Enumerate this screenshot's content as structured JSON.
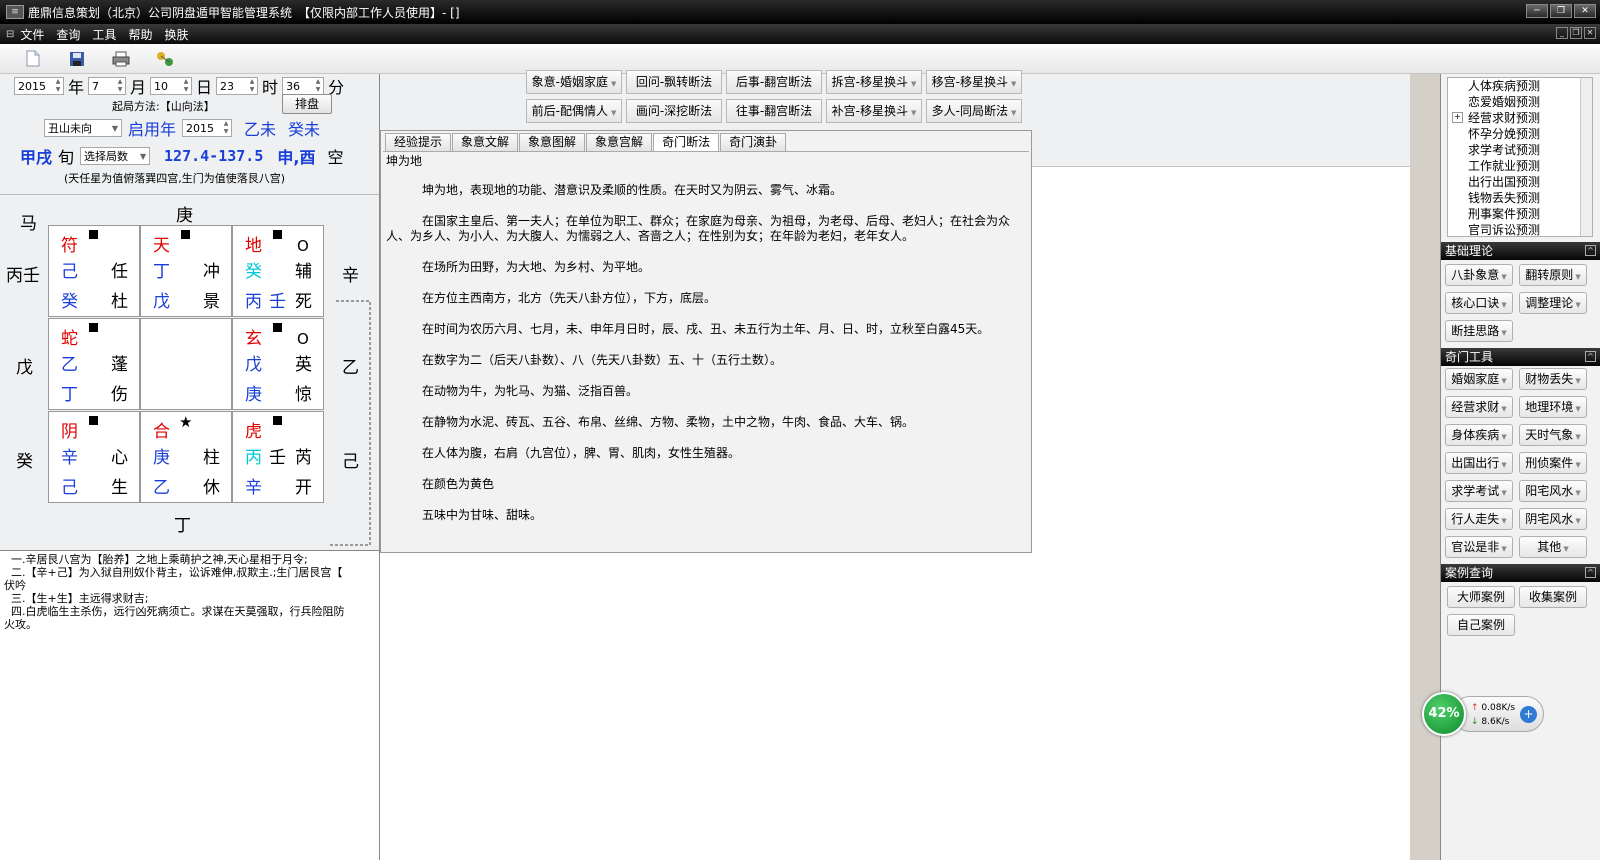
{
  "titlebar": {
    "title": "鹿鼎信息策划（北京）公司阴盘遁甲智能管理系统　【仅限内部工作人员使用】- []"
  },
  "menu": [
    "文件",
    "查询",
    "工具",
    "帮助",
    "换肤"
  ],
  "toolbar": {
    "icons": [
      "document-icon",
      "save-icon",
      "print-icon",
      "network-icon"
    ]
  },
  "left": {
    "date": {
      "year": "2015",
      "year_lbl": "年",
      "month": "7",
      "month_lbl": "月",
      "day": "10",
      "day_lbl": "日",
      "hour": "23",
      "hour_lbl": "时",
      "minute": "36",
      "minute_lbl": "分"
    },
    "method_label": "起局方法:【山向法】",
    "paipan_button": "排盘",
    "mountain": "丑山未向",
    "qiyong_label": "启用年",
    "qiyong_year": "2015",
    "ganzhi1": "乙未",
    "ganzhi2": "癸未",
    "xun_name": "甲戌",
    "xun_lbl": "旬",
    "select_ju": "选择局数",
    "degree": "127.4-137.5",
    "kong": "申,酉",
    "kong_lbl": "空",
    "note": "(天任星为值俯落巽四宫,生门为值使落艮八宫)"
  },
  "chart": {
    "outer": {
      "ma": "马",
      "top": "庚",
      "left1": "丙壬",
      "left2": "戊",
      "left3": "癸",
      "right1": "辛",
      "right2": "乙",
      "right3": "己",
      "bottom": "丁"
    },
    "cells": {
      "c1": {
        "god": "符",
        "stem1": "己",
        "star": "任",
        "stem2": "癸",
        "door": "杜"
      },
      "c2": {
        "god": "天",
        "stem1": "丁",
        "star": "冲",
        "stem2": "戊",
        "door": "景"
      },
      "c3": {
        "god": "地",
        "stem1": "癸",
        "star": "辅",
        "stem2": "丙",
        "extra": "壬",
        "door": "死",
        "mark": "O"
      },
      "c4": {
        "god": "蛇",
        "stem1": "乙",
        "star": "蓬",
        "stem2": "丁",
        "door": "伤"
      },
      "c6": {
        "god": "玄",
        "stem1": "戊",
        "star": "英",
        "stem2": "庚",
        "door": "惊",
        "mark": "O"
      },
      "c7": {
        "god": "阴",
        "stem1": "辛",
        "star": "心",
        "stem2": "己",
        "door": "生"
      },
      "c8": {
        "god": "合",
        "stem1": "庚",
        "star": "柱",
        "stem2": "乙",
        "door": "休",
        "mark": "★"
      },
      "c9": {
        "god": "虎",
        "stem1": "丙",
        "extra": "壬",
        "star": "芮",
        "stem2": "辛",
        "door": "开"
      }
    }
  },
  "analysis": "  一.辛居艮八宫为【胎养】之地上乘萌护之神,天心星相于月令;\n  二.【辛+己】为入狱自刑奴仆背主，讼诉难伸,叔欺主.;生门居艮宫【\n伏吟\n  三.【生+生】主远得求财吉;\n  四.白虎临生主杀伤，远行凶死病须亡。求谋在天莫强取，行兵险阻防\n火攻。",
  "middle": {
    "buttons_row1": [
      "象意-婚姻家庭",
      "回问-飘转断法",
      "后事-翻宫断法",
      "拆宫-移星换斗",
      "移宫-移星换斗"
    ],
    "buttons_row2": [
      "前后-配偶情人",
      "画问-深挖断法",
      "往事-翻宫断法",
      "补宫-移星换斗",
      "多人-同局断法"
    ],
    "tabs": [
      "经验提示",
      "象意文解",
      "象意图解",
      "象意宫解",
      "奇门断法",
      "奇门演卦"
    ],
    "active_tab": "奇门断法",
    "content": [
      "坤为地",
      "坤为地，表现地的功能、潜意识及柔顺的性质。在天时又为阴云、雾气、冰霜。",
      "在国家主皇后、第一夫人；在单位为职工、群众；在家庭为母亲、为祖母，为老母、后母、老妇人；在社会为众人、为乡人、为小人、为大腹人、为懦弱之人、吝啬之人；在性别为女；在年龄为老妇，老年女人。",
      "在场所为田野，为大地、为乡村、为平地。",
      "在方位主西南方，北方（先天八卦方位），下方，底层。",
      "在时间为农历六月、七月，未、申年月日时，辰、戌、丑、未五行为土年、月、日、时，立秋至白露45天。",
      "在数字为二（后天八卦数）、八（先天八卦数）五、十（五行土数）。",
      "在动物为牛，为牝马、为猫、泛指百兽。",
      "在静物为水泥、砖瓦、五谷、布帛、丝绵、方物、柔物，土中之物，牛肉、食品、大车、锅。",
      "在人体为腹，右肩（九宫位），脾、胃、肌肉，女性生殖器。",
      "在颜色为黄色",
      "五味中为甘味、甜味。"
    ]
  },
  "right": {
    "tree": [
      "人体疾病预测",
      "恋爱婚姻预测",
      "经营求财预测",
      "怀孕分娩预测",
      "求学考试预测",
      "工作就业预测",
      "出行出国预测",
      "钱物丢失预测",
      "刑事案件预测",
      "官司诉讼预测"
    ],
    "sec1_title": "基础理论",
    "sec1_buttons": [
      "八卦象意",
      "翻转原则",
      "核心口诀",
      "调整理论",
      "断挂思路"
    ],
    "sec2_title": "奇门工具",
    "sec2_buttons": [
      "婚姻家庭",
      "财物丢失",
      "经营求财",
      "地理环境",
      "身体疾病",
      "天时气象",
      "出国出行",
      "刑侦案件",
      "求学考试",
      "阳宅风水",
      "行人走失",
      "阴宅风水",
      "官讼是非",
      "其他"
    ],
    "sec3_title": "案例查询",
    "sec3_buttons": [
      "大师案例",
      "收集案例",
      "自己案例"
    ]
  },
  "speed": {
    "percent": "42%",
    "up": "0.08K/s",
    "down": "8.6K/s",
    "color": "#1ea53c"
  }
}
